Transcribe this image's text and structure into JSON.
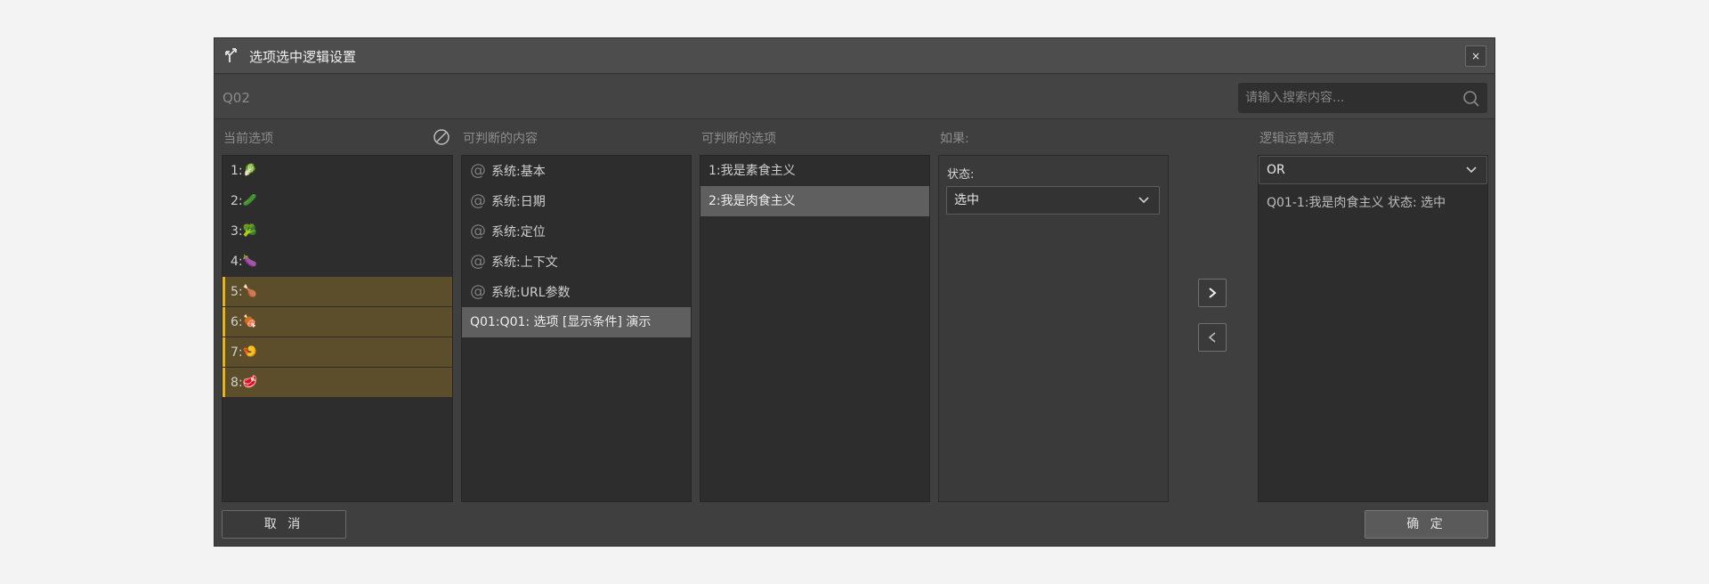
{
  "window": {
    "title": "选项选中逻辑设置",
    "close_label": "×"
  },
  "subbar": {
    "question": "Q02",
    "search_placeholder": "请输入搜索内容..."
  },
  "columns": {
    "current": {
      "header": "当前选项",
      "items": [
        {
          "label": "1:",
          "emoji": "🥬",
          "highlighted": false
        },
        {
          "label": "2:",
          "emoji": "🥒",
          "highlighted": false
        },
        {
          "label": "3:",
          "emoji": "🥦",
          "highlighted": false
        },
        {
          "label": "4:",
          "emoji": "🍆",
          "highlighted": false
        },
        {
          "label": "5:",
          "emoji": "🍗",
          "highlighted": true
        },
        {
          "label": "6:",
          "emoji": "🍖",
          "highlighted": true
        },
        {
          "label": "7:",
          "emoji": "🍤",
          "highlighted": true
        },
        {
          "label": "8:",
          "emoji": "🥩",
          "highlighted": true
        }
      ]
    },
    "judgeable": {
      "header": "可判断的内容",
      "items": [
        "系统:基本",
        "系统:日期",
        "系统:定位",
        "系统:上下文",
        "系统:URL参数"
      ],
      "selected": "Q01:Q01: 选项 [显示条件] 演示",
      "at_symbol": "@"
    },
    "options": {
      "header": "可判断的选项",
      "items": [
        "1:我是素食主义",
        "2:我是肉食主义"
      ],
      "selected_index": 1
    },
    "if": {
      "header": "如果:",
      "state_label": "状态:",
      "state_value": "选中"
    },
    "logic": {
      "header": "逻辑运算选项",
      "operator": "OR",
      "rules": [
        "Q01-1:我是肉食主义 状态: 选中"
      ]
    }
  },
  "buttons": {
    "cancel": "取 消",
    "confirm": "确 定"
  },
  "colors": {
    "highlight_bg": "#5d4e2b",
    "highlight_bar": "#e8b41c",
    "selected_bg": "#5f5f5f"
  },
  "icons": {
    "title": "branch-arrows-icon",
    "search": "search-icon",
    "clear": "ban-icon",
    "add": "chevron-right-icon",
    "remove": "chevron-left-icon"
  }
}
